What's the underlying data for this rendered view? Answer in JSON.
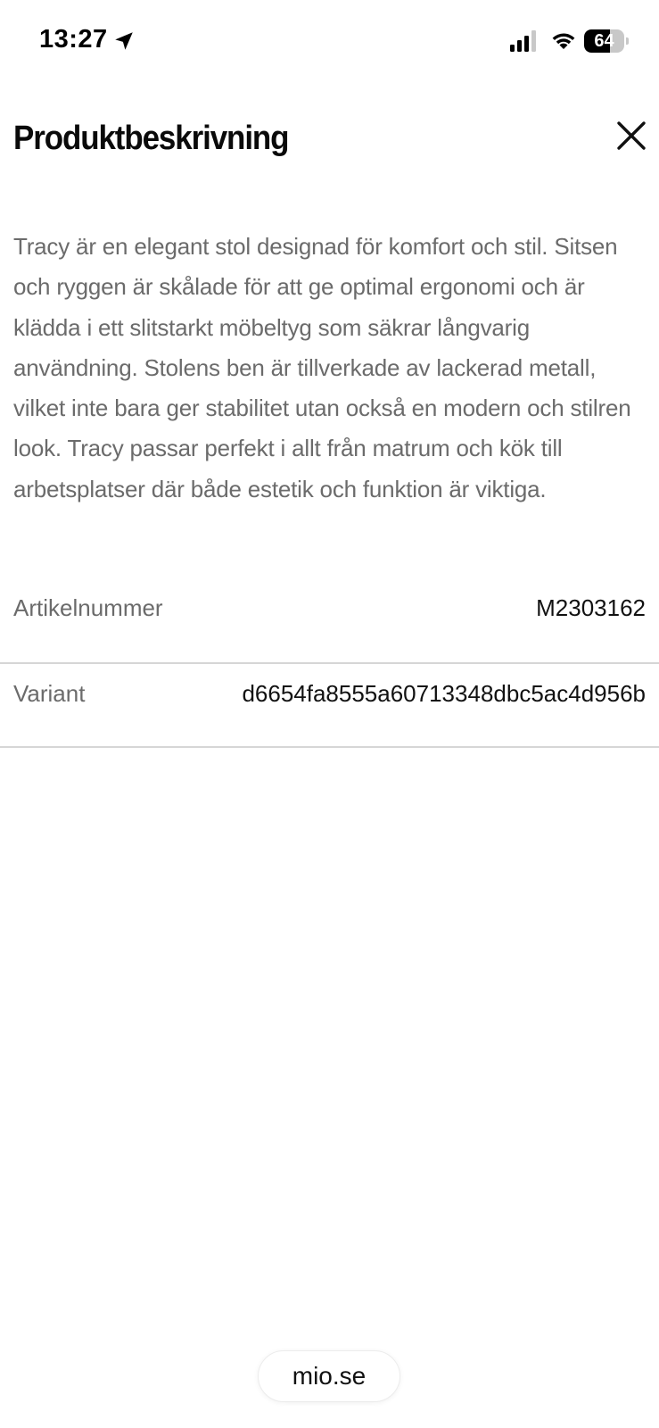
{
  "status_bar": {
    "time": "13:27",
    "battery_level": 64,
    "battery_text": "64",
    "icons": [
      "location-arrow-icon",
      "cellular-signal-icon",
      "wifi-icon",
      "battery-icon"
    ]
  },
  "header": {
    "title": "Produktbeskrivning",
    "close_icon": "close-icon"
  },
  "description": "Tracy är en elegant stol designad för komfort och stil. Sitsen och ryggen är skålade för att ge optimal ergonomi och är klädda i ett slitstarkt möbeltyg som säkrar långvarig användning. Stolens ben är tillverkade av lackerad metall, vilket inte bara ger stabilitet utan också en modern och stilren look. Tracy passar perfekt i allt från matrum och kök till arbetsplatser där både estetik och funktion är viktiga.",
  "details": [
    {
      "label": "Artikelnummer",
      "value": "M2303162"
    },
    {
      "label": "Variant",
      "value": "d6654fa8555a60713348dbc5ac4d956b"
    }
  ],
  "browser": {
    "url": "mio.se"
  },
  "colors": {
    "text_primary": "#111111",
    "text_secondary": "#6b6b6b",
    "divider": "#d6d6d6",
    "background": "#ffffff"
  }
}
